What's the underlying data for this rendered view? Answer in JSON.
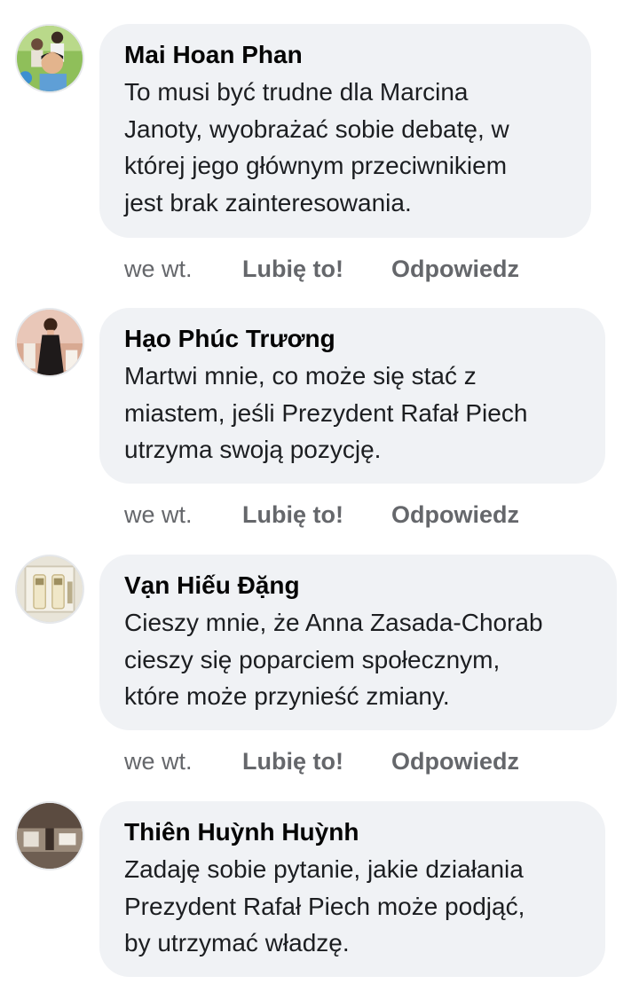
{
  "comments": [
    {
      "author": "Mai Hoan Phan",
      "avatar_icon": "avatar-boy-outdoor",
      "lines": [
        "To musi być trudne dla Marcina",
        "Janoty, wyobrażać sobie debatę, w",
        "której jego głównym przeciwnikiem",
        "jest brak zainteresowania."
      ],
      "time": "we wt.",
      "like_label": "Lubię to!",
      "reply_label": "Odpowiedz"
    },
    {
      "author": "Hạo Phúc Trương",
      "avatar_icon": "avatar-woman-dress",
      "lines": [
        "Martwi mnie, co może się stać z",
        "miastem, jeśli Prezydent Rafał Piech",
        "utrzyma swoją pozycję."
      ],
      "time": "we wt.",
      "like_label": "Lubię to!",
      "reply_label": "Odpowiedz"
    },
    {
      "author": "Vạn Hiếu Đặng",
      "avatar_icon": "avatar-cosmetic-products",
      "lines": [
        "Cieszy mnie, że Anna Zasada-Chorab",
        "cieszy się poparciem społecznym,",
        "które może przynieść zmiany."
      ],
      "time": "we wt.",
      "like_label": "Lubię to!",
      "reply_label": "Odpowiedz"
    },
    {
      "author": "Thiên Huỳnh Huỳnh",
      "avatar_icon": "avatar-interior-room",
      "lines": [
        "Zadaję sobie pytanie, jakie działania",
        "Prezydent Rafał Piech może podjąć,",
        "by utrzymać władzę."
      ]
    }
  ],
  "colors": {
    "bubble_background": "#f0f2f5",
    "author_text": "#050505",
    "body_text": "#1c1e21",
    "action_text": "#65676b"
  }
}
